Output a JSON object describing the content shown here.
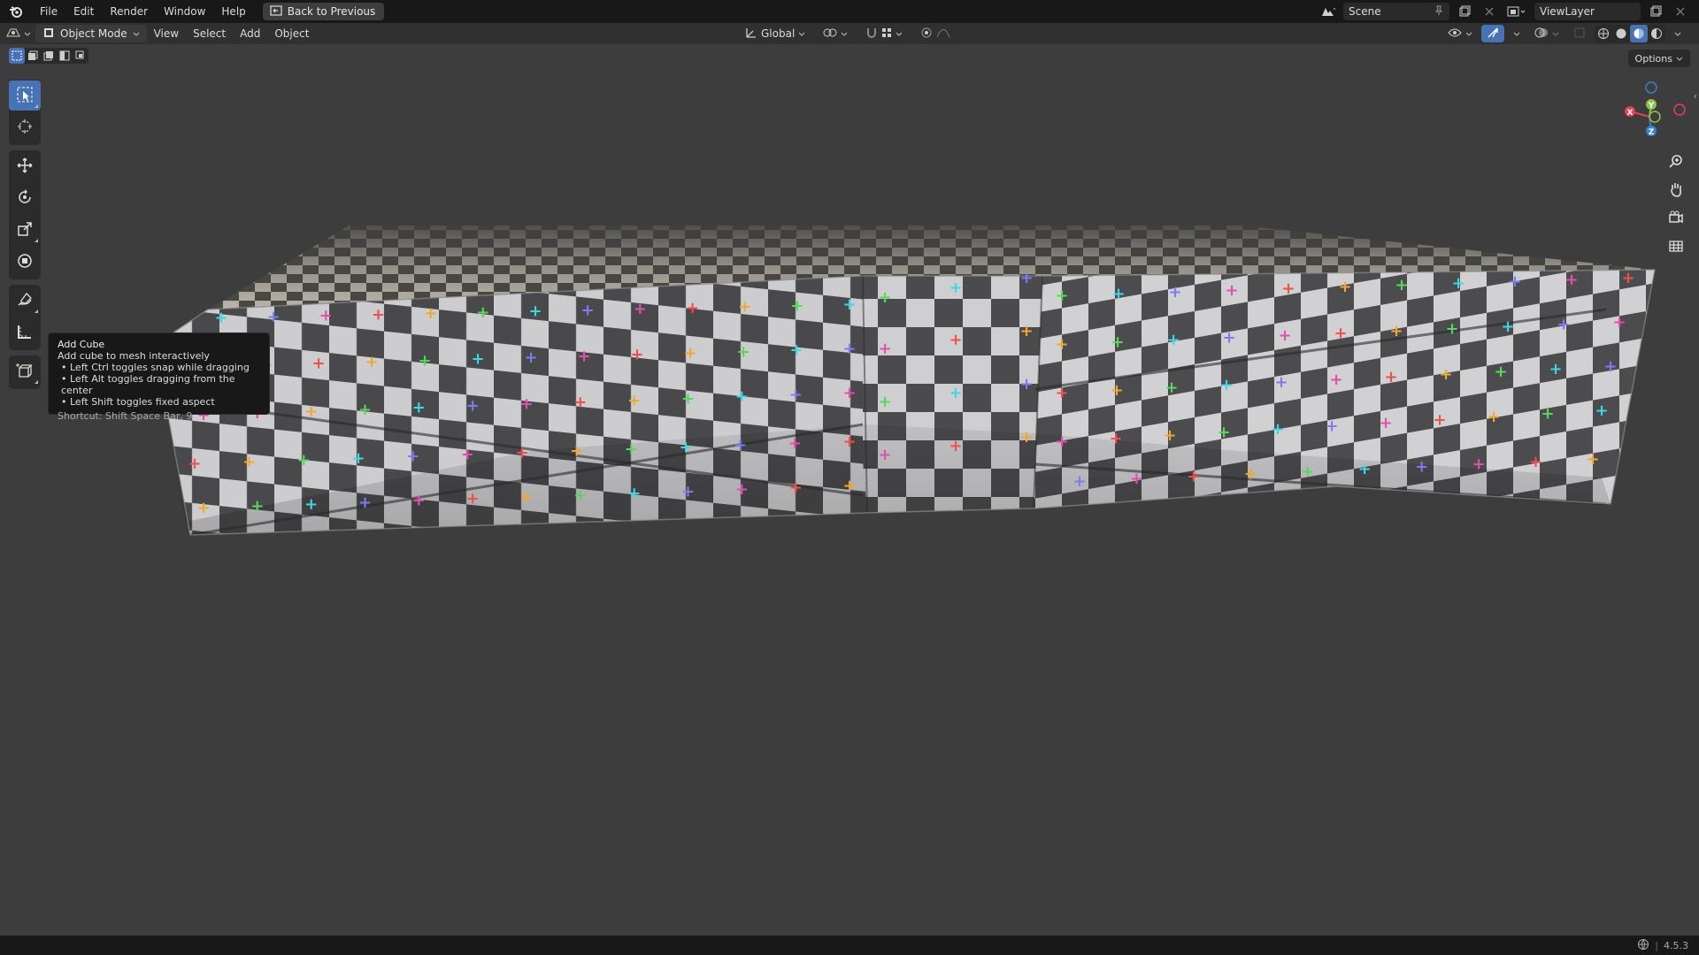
{
  "menubar": {
    "items": [
      "File",
      "Edit",
      "Render",
      "Window",
      "Help"
    ],
    "back_button": "Back to Previous",
    "scene_name": "Scene",
    "view_layer": "ViewLayer"
  },
  "viewport_header": {
    "mode": "Object Mode",
    "menus": [
      "View",
      "Select",
      "Add",
      "Object"
    ],
    "transform_orientation": "Global",
    "active_shading": "material-preview"
  },
  "viewport": {
    "options_label": "Options"
  },
  "toolbar": {
    "tools": [
      {
        "name": "select-box-tool",
        "icon": "select-box-icon",
        "active": true
      },
      {
        "name": "cursor-tool",
        "icon": "cursor-icon",
        "active": false
      },
      {
        "name": "move-tool",
        "icon": "move-icon",
        "active": false
      },
      {
        "name": "rotate-tool",
        "icon": "rotate-icon",
        "active": false
      },
      {
        "name": "scale-tool",
        "icon": "scale-icon",
        "active": false
      },
      {
        "name": "transform-tool",
        "icon": "transform-icon",
        "active": false
      },
      {
        "name": "annotate-tool",
        "icon": "annotate-icon",
        "active": false
      },
      {
        "name": "measure-tool",
        "icon": "measure-icon",
        "active": false
      },
      {
        "name": "add-cube-tool",
        "icon": "add-cube-icon",
        "active": false
      }
    ]
  },
  "tooltip": {
    "title": "Add Cube",
    "description": "Add cube to mesh interactively",
    "bullets": [
      "Left Ctrl toggles snap while dragging",
      "Left Alt toggles dragging from the center",
      "Left Shift toggles fixed aspect"
    ],
    "shortcut": "Shortcut: Shift Space Bar, 9"
  },
  "gizmo": {
    "x_label": "X",
    "y_label": "Y",
    "z_label": "Z",
    "colors": {
      "x": "#e2415a",
      "y": "#8bc34a",
      "z": "#3a7fd0"
    }
  },
  "statusbar": {
    "version": "4.5.3"
  },
  "colors": {
    "accent": "#4772b3",
    "viewport_bg": "#3d3d3d",
    "header_bg": "#303030",
    "topbar_bg": "#181818"
  }
}
